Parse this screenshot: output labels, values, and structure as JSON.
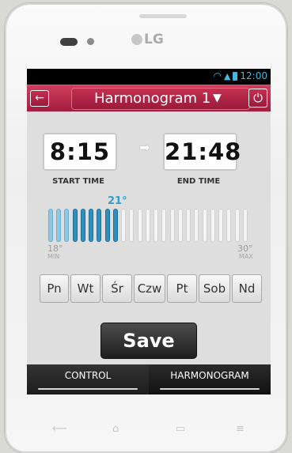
{
  "device": {
    "brand_logo": "LG"
  },
  "status_bar": {
    "time": "12:00"
  },
  "header": {
    "title": "Harmonogram 1",
    "back_icon": "back-arrow-icon",
    "dropdown_icon": "caret-down-icon",
    "power_icon": "power-icon"
  },
  "schedule": {
    "start_time": "8:15",
    "start_label": "START TIME",
    "end_time": "21:48",
    "end_label": "END TIME"
  },
  "temperature": {
    "current": "21°",
    "min_value": "18°",
    "min_label": "MIN",
    "max_value": "30°",
    "max_label": "MAX",
    "total_steps": 25,
    "active_steps": 9
  },
  "days": [
    "Pn",
    "Wt",
    "Śr",
    "Czw",
    "Pt",
    "Sob",
    "Nd"
  ],
  "save_label": "Save",
  "tabs": [
    {
      "label": "CONTROL"
    },
    {
      "label": "HARMONOGRAM"
    }
  ],
  "colors": {
    "header": "#b8284a",
    "accent_blue": "#2e8fbf",
    "tab_bar": "#1b1b1b"
  }
}
